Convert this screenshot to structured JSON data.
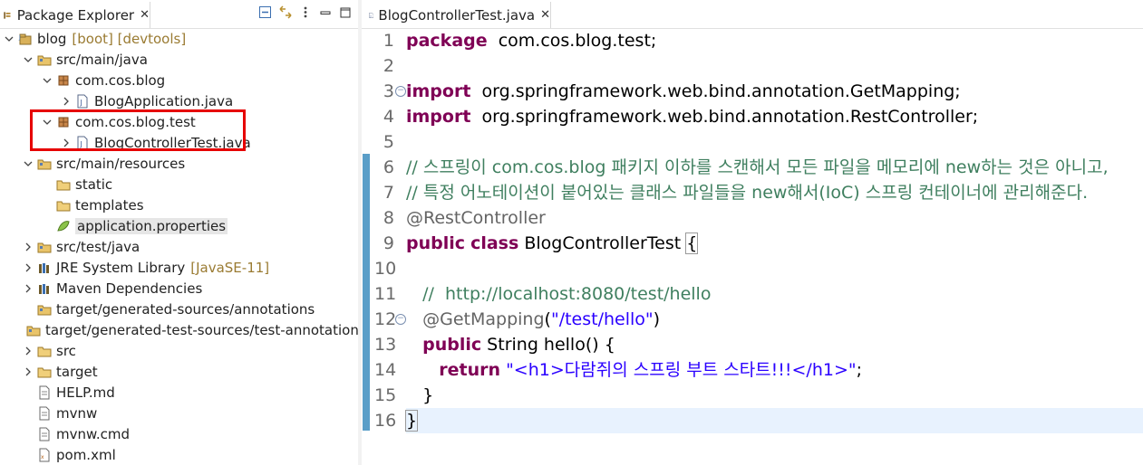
{
  "package_explorer": {
    "tab_title": "Package Explorer",
    "tab_close": "✕",
    "toolbar": [
      "collapse-all-icon",
      "link-with-editor-icon",
      "view-menu-icon",
      "minimize-icon",
      "maximize-icon"
    ],
    "tree": [
      {
        "label": "blog",
        "deco": "[boot] [devtools]",
        "icon": "project-icon",
        "expanded": true,
        "depth": 0
      },
      {
        "label": "src/main/java",
        "icon": "source-folder-icon",
        "expanded": true,
        "depth": 1
      },
      {
        "label": "com.cos.blog",
        "icon": "package-icon",
        "expanded": true,
        "depth": 2
      },
      {
        "label": "BlogApplication.java",
        "icon": "java-file-icon",
        "expanded": false,
        "depth": 3
      },
      {
        "label": "com.cos.blog.test",
        "icon": "package-icon",
        "expanded": true,
        "depth": 2
      },
      {
        "label": "BlogControllerTest.java",
        "icon": "java-file-icon",
        "expanded": false,
        "depth": 3
      },
      {
        "label": "src/main/resources",
        "icon": "source-folder-icon",
        "expanded": true,
        "depth": 1
      },
      {
        "label": "static",
        "icon": "folder-icon",
        "depth": 2
      },
      {
        "label": "templates",
        "icon": "folder-icon",
        "depth": 2
      },
      {
        "label": "application.properties",
        "icon": "properties-file-icon",
        "depth": 2,
        "selected": true
      },
      {
        "label": "src/test/java",
        "icon": "source-folder-icon",
        "expanded": false,
        "depth": 1
      },
      {
        "label": "JRE System Library",
        "deco": "[JavaSE-11]",
        "icon": "library-icon",
        "expanded": false,
        "depth": 1
      },
      {
        "label": "Maven Dependencies",
        "icon": "library-icon",
        "expanded": false,
        "depth": 1
      },
      {
        "label": "target/generated-sources/annotations",
        "icon": "source-folder-icon",
        "depth": 1
      },
      {
        "label": "target/generated-test-sources/test-annotations",
        "icon": "source-folder-icon",
        "depth": 1
      },
      {
        "label": "src",
        "icon": "folder-icon",
        "expanded": false,
        "depth": 1
      },
      {
        "label": "target",
        "icon": "folder-icon",
        "expanded": false,
        "depth": 1
      },
      {
        "label": "HELP.md",
        "icon": "text-file-icon",
        "depth": 1
      },
      {
        "label": "mvnw",
        "icon": "text-file-icon",
        "depth": 1
      },
      {
        "label": "mvnw.cmd",
        "icon": "text-file-icon",
        "depth": 1
      },
      {
        "label": "pom.xml",
        "icon": "xml-file-icon",
        "depth": 1
      }
    ]
  },
  "editor": {
    "tab_title": "BlogControllerTest.java",
    "tab_close": "✕",
    "lines": [
      {
        "n": "1",
        "tokens": [
          [
            "kw",
            "package"
          ],
          [
            "",
            "  com.cos.blog.test;"
          ]
        ]
      },
      {
        "n": "2",
        "tokens": []
      },
      {
        "n": "3",
        "fold": true,
        "tokens": [
          [
            "kw",
            "import"
          ],
          [
            "",
            "  org.springframework.web.bind.annotation.GetMapping;"
          ]
        ]
      },
      {
        "n": "4",
        "tokens": [
          [
            "kw",
            "import"
          ],
          [
            "",
            "  org.springframework.web.bind.annotation.RestController;"
          ]
        ]
      },
      {
        "n": "5",
        "tokens": []
      },
      {
        "n": "6",
        "tokens": [
          [
            "cm",
            "// 스프링이 com.cos.blog 패키지 이하를 스캔해서 모든 파일을 메모리에 new하는 것은 아니고,"
          ]
        ]
      },
      {
        "n": "7",
        "tokens": [
          [
            "cm",
            "// 특정 어노테이션이 붙어있는 클래스 파일들을 new해서(IoC) 스프링 컨테이너에 관리해준다."
          ]
        ]
      },
      {
        "n": "8",
        "tokens": [
          [
            "an",
            "@RestController"
          ]
        ]
      },
      {
        "n": "9",
        "tokens": [
          [
            "kw",
            "public"
          ],
          [
            "",
            " "
          ],
          [
            "kw",
            "class"
          ],
          [
            "",
            " BlogControllerTest "
          ],
          [
            "br",
            "{"
          ]
        ]
      },
      {
        "n": "10",
        "tokens": []
      },
      {
        "n": "11",
        "tokens": [
          [
            "",
            "   "
          ],
          [
            "cm",
            "//  http://localhost:8080/test/hello"
          ]
        ]
      },
      {
        "n": "12",
        "fold": true,
        "tokens": [
          [
            "",
            "   "
          ],
          [
            "an",
            "@GetMapping"
          ],
          [
            "",
            "("
          ],
          [
            "st",
            "\"/test/hello\""
          ],
          [
            "",
            ")"
          ]
        ]
      },
      {
        "n": "13",
        "tokens": [
          [
            "",
            "   "
          ],
          [
            "kw",
            "public"
          ],
          [
            "",
            " String hello() {"
          ]
        ]
      },
      {
        "n": "14",
        "tokens": [
          [
            "",
            "      "
          ],
          [
            "kw",
            "return"
          ],
          [
            "",
            " "
          ],
          [
            "st",
            "\"<h1>다람쥐의 스프링 부트 스타트!!!</h1>\""
          ],
          [
            "",
            ";"
          ]
        ]
      },
      {
        "n": "15",
        "tokens": [
          [
            "",
            "   }"
          ]
        ]
      },
      {
        "n": "16",
        "tokens": [
          [
            "br",
            "}"
          ]
        ]
      }
    ]
  },
  "colors": {
    "keyword": "#7f0055",
    "comment": "#3f7f5f",
    "annotation": "#646464",
    "string": "#2a00ff",
    "highlight_box": "#e60000",
    "current_line": "#e8f2fe"
  }
}
